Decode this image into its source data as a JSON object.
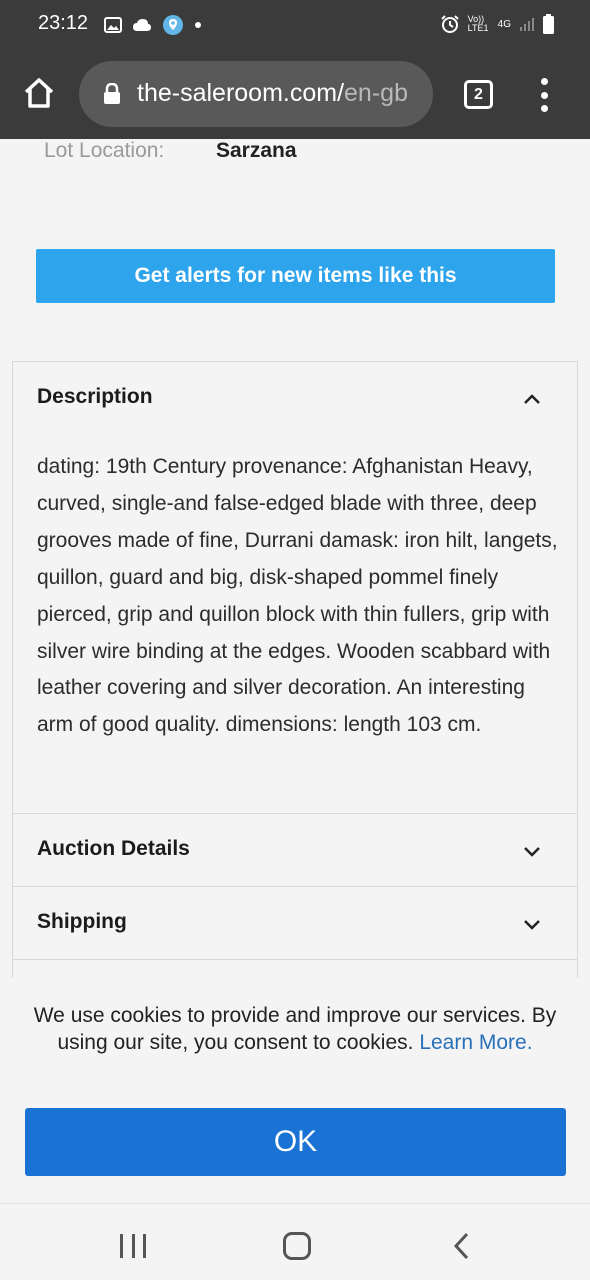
{
  "status": {
    "time": "23:12",
    "network_label": "Vo)) LTE1",
    "signal_label": "4G"
  },
  "browser": {
    "url_main": "the-saleroom.com/",
    "url_path": "en-gb",
    "tab_count": "2"
  },
  "lot": {
    "location_label": "Lot Location:",
    "location_value": "Sarzana"
  },
  "alert_button_label": "Get alerts for new items like this",
  "sections": {
    "description": {
      "title": "Description",
      "text": "dating: 19th Century provenance: Afghanistan Heavy, curved, single-and false-edged blade with three, deep grooves made of fine, Durrani damask: iron hilt, langets, quillon, guard and big, disk-shaped pommel finely pierced, grip and quillon block with thin fullers, grip with silver wire binding at the edges. Wooden scabbard with leather covering and silver decoration. An interesting arm of good quality. dimensions: length 103 cm."
    },
    "auction_details": {
      "title": "Auction Details"
    },
    "shipping": {
      "title": "Shipping"
    }
  },
  "cookie": {
    "text": "We use cookies to provide and improve our services. By using our site, you consent to cookies.",
    "link_text": "Learn More.",
    "ok_label": "OK"
  },
  "colors": {
    "accent": "#2ea4ec",
    "ok_button": "#1a73d4",
    "link": "#2a6fba",
    "chrome": "#3b3b3b"
  },
  "icons": [
    "home-icon",
    "lock-icon",
    "tabs-icon",
    "more-vert-icon",
    "chevron-up-icon",
    "chevron-down-icon",
    "recent-apps-icon",
    "nav-home-icon",
    "back-icon"
  ]
}
